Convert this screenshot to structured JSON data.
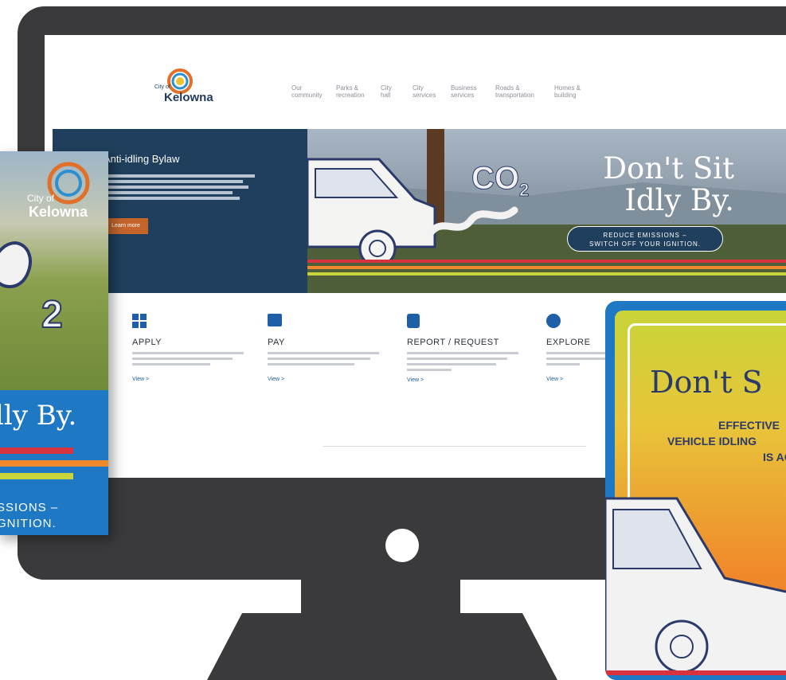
{
  "website": {
    "logo": {
      "small": "City of",
      "name": "Kelowna"
    },
    "nav": [
      "Our community",
      "Parks & recreation",
      "City hall",
      "City services",
      "Business services",
      "Roads & transportation",
      "Homes & building"
    ],
    "hero": {
      "title": "Anti-idling Bylaw",
      "cta": "Learn more",
      "slogan_line1": "Don't Sit",
      "slogan_line2": "Idly By.",
      "badge_line1": "REDUCE EMISSIONS –",
      "badge_line2": "SWITCH OFF YOUR IGNITION.",
      "co2": "CO",
      "co2_sub": "2"
    },
    "cards": [
      {
        "title": "APPLY",
        "link": "View >"
      },
      {
        "title": "PAY",
        "link": "View >"
      },
      {
        "title": "REPORT / REQUEST",
        "link": "View >"
      },
      {
        "title": "EXPLORE",
        "link": "View >"
      }
    ]
  },
  "poster_left": {
    "small": "City of",
    "name": "Kelowna",
    "co2_sub": "2",
    "slogan": "lly By.",
    "bottom_line1": "SSIONS –",
    "bottom_line2": "GNITION."
  },
  "poster_right": {
    "title": "Don't S",
    "line1": "EFFECTIVE",
    "line2": "VEHICLE IDLING",
    "line3": "IS AC"
  },
  "colors": {
    "monitor": "#3a3a3c",
    "navy": "#1f3f5c",
    "blue": "#1f78c4",
    "red": "#d8323e",
    "orange": "#f0892b",
    "yellowgreen": "#c8d439"
  }
}
